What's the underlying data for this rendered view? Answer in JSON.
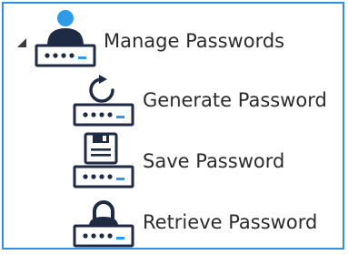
{
  "tree": {
    "root": {
      "label": "Manage Passwords",
      "icon": "user-password-icon",
      "expanded": true,
      "expander_icon": "expanded-triangle-icon"
    },
    "children": [
      {
        "label": "Generate Password",
        "icon": "generate-password-icon"
      },
      {
        "label": "Save Password",
        "icon": "save-password-icon"
      },
      {
        "label": "Retrieve Password",
        "icon": "retrieve-password-icon"
      }
    ]
  },
  "colors": {
    "border": "#2f8fe0",
    "icon_dark": "#1f2a44",
    "icon_accent": "#2f9be8",
    "text": "#2b2b2b"
  }
}
